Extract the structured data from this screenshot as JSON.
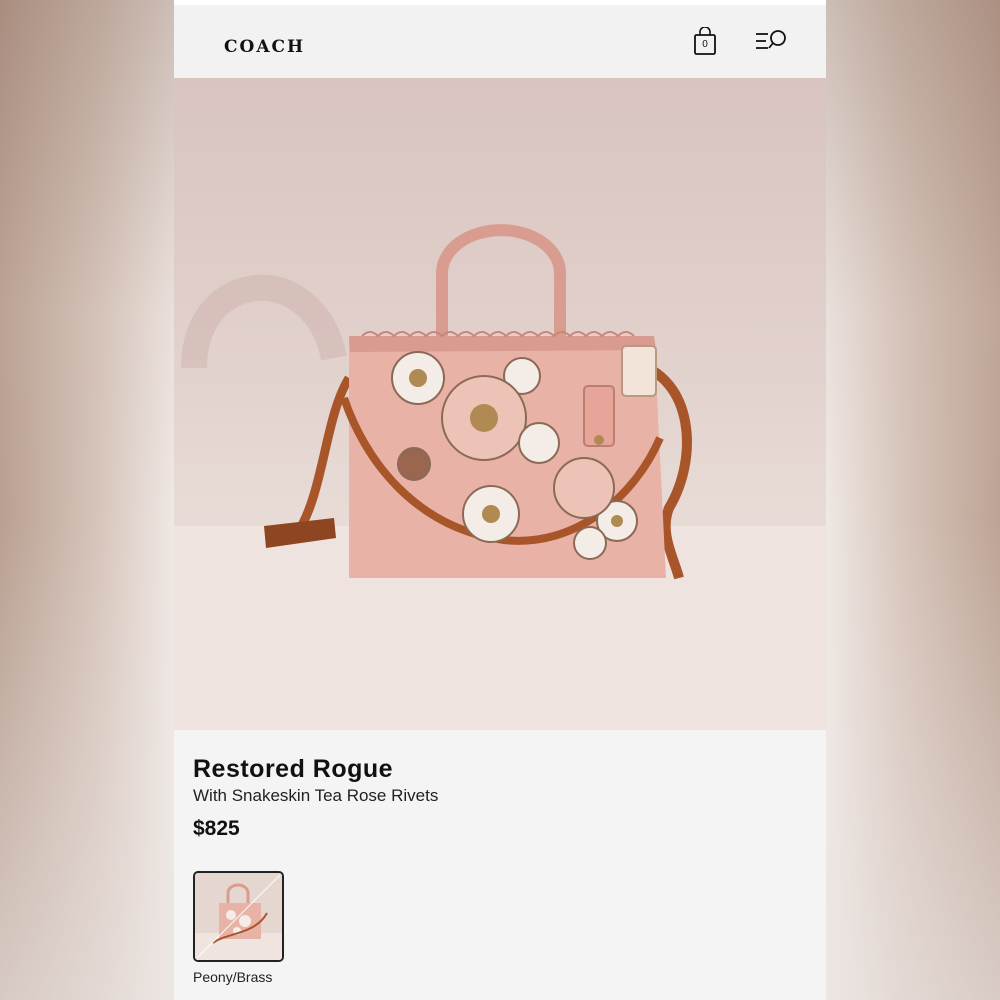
{
  "header": {
    "logo": "COACH",
    "bag_count": "0",
    "icons": [
      "shopping-bag-icon",
      "menu-search-icon"
    ]
  },
  "hero": {
    "image": "product-photo-handbag"
  },
  "product": {
    "name": "Restored Rogue",
    "subtitle": "With Snakeskin Tea Rose Rivets",
    "price": "$825"
  },
  "swatches": [
    {
      "label": "Peony/Brass",
      "selected": true
    }
  ],
  "colors": {
    "text": "#111111",
    "background": "#f4f4f4",
    "bag_pink": "#e9b2a6",
    "strap_tan": "#a9552a"
  }
}
